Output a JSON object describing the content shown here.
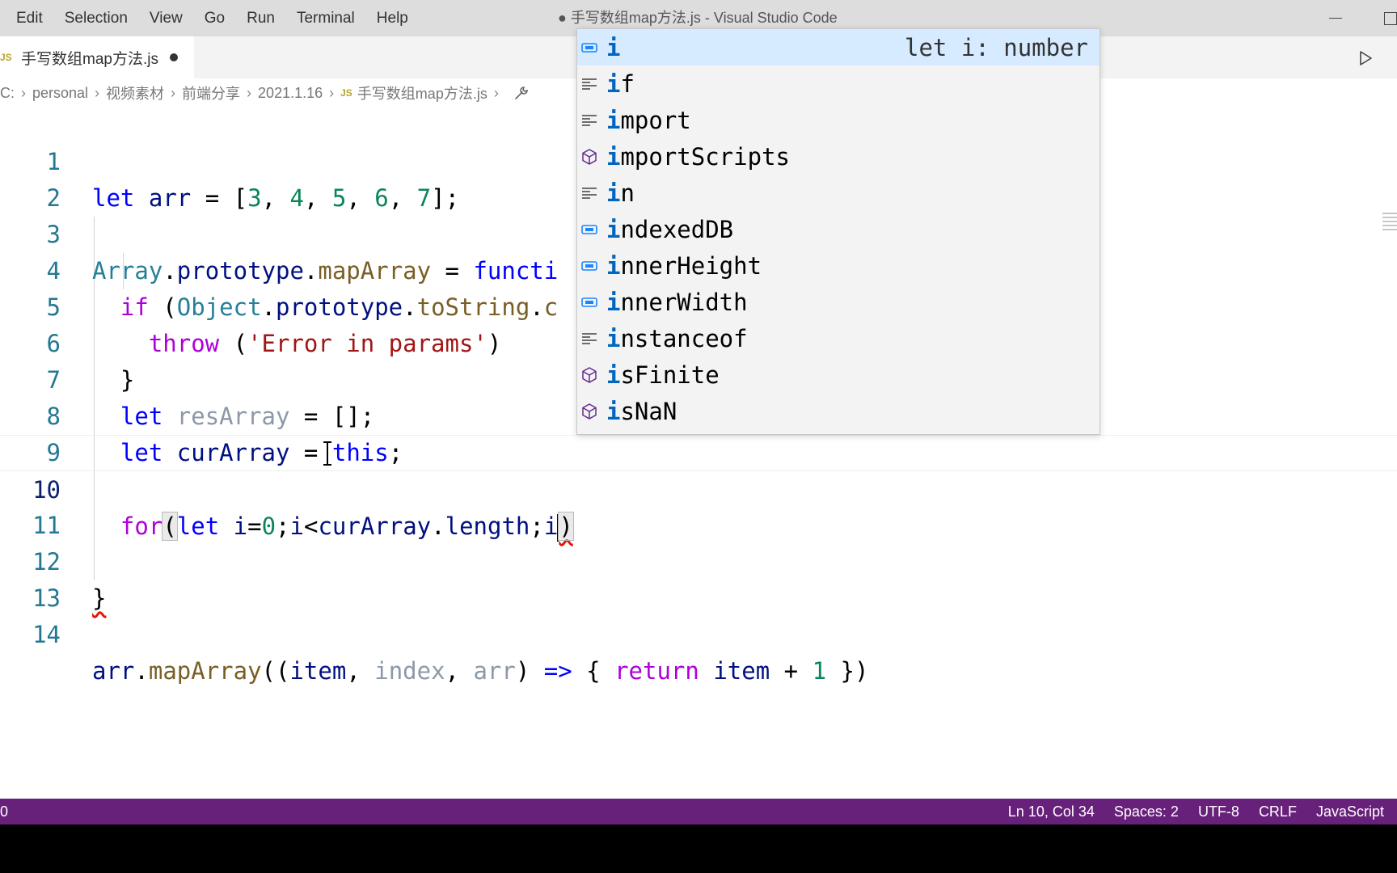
{
  "menu": [
    "Edit",
    "Selection",
    "View",
    "Go",
    "Run",
    "Terminal",
    "Help"
  ],
  "window_title": "● 手写数组map方法.js - Visual Studio Code",
  "tab": {
    "lang_badge": "JS",
    "label": "手写数组map方法.js"
  },
  "breadcrumb": {
    "items": [
      "C:",
      "personal",
      "视频素材",
      "前端分享",
      "2021.1.16"
    ],
    "file_badge": "JS",
    "file": "手写数组map方法.js"
  },
  "line_numbers": [
    "1",
    "2",
    "3",
    "4",
    "5",
    "6",
    "7",
    "8",
    "9",
    "10",
    "11",
    "12",
    "13",
    "14"
  ],
  "suggest": [
    {
      "prefix": "i",
      "rest": "",
      "icon": "variable-icon",
      "detail": "let i: number"
    },
    {
      "prefix": "i",
      "rest": "f",
      "icon": "keyword-icon"
    },
    {
      "prefix": "i",
      "rest": "mport",
      "icon": "keyword-icon"
    },
    {
      "prefix": "i",
      "rest": "mportScripts",
      "icon": "method-icon"
    },
    {
      "prefix": "i",
      "rest": "n",
      "icon": "keyword-icon"
    },
    {
      "prefix": "i",
      "rest": "ndexedDB",
      "icon": "variable-icon"
    },
    {
      "prefix": "i",
      "rest": "nnerHeight",
      "icon": "variable-icon"
    },
    {
      "prefix": "i",
      "rest": "nnerWidth",
      "icon": "variable-icon"
    },
    {
      "prefix": "i",
      "rest": "nstanceof",
      "icon": "keyword-icon"
    },
    {
      "prefix": "i",
      "rest": "sFinite",
      "icon": "method-icon"
    },
    {
      "prefix": "i",
      "rest": "sNaN",
      "icon": "method-icon"
    }
  ],
  "status": {
    "left": "0",
    "position": "Ln 10, Col 34",
    "spaces": "Spaces: 2",
    "encoding": "UTF-8",
    "eol": "CRLF",
    "language": "JavaScript"
  },
  "colors": {
    "status_bar": "#68217a",
    "suggest_selected": "#d6ebff",
    "match_highlight": "#0066bf"
  }
}
